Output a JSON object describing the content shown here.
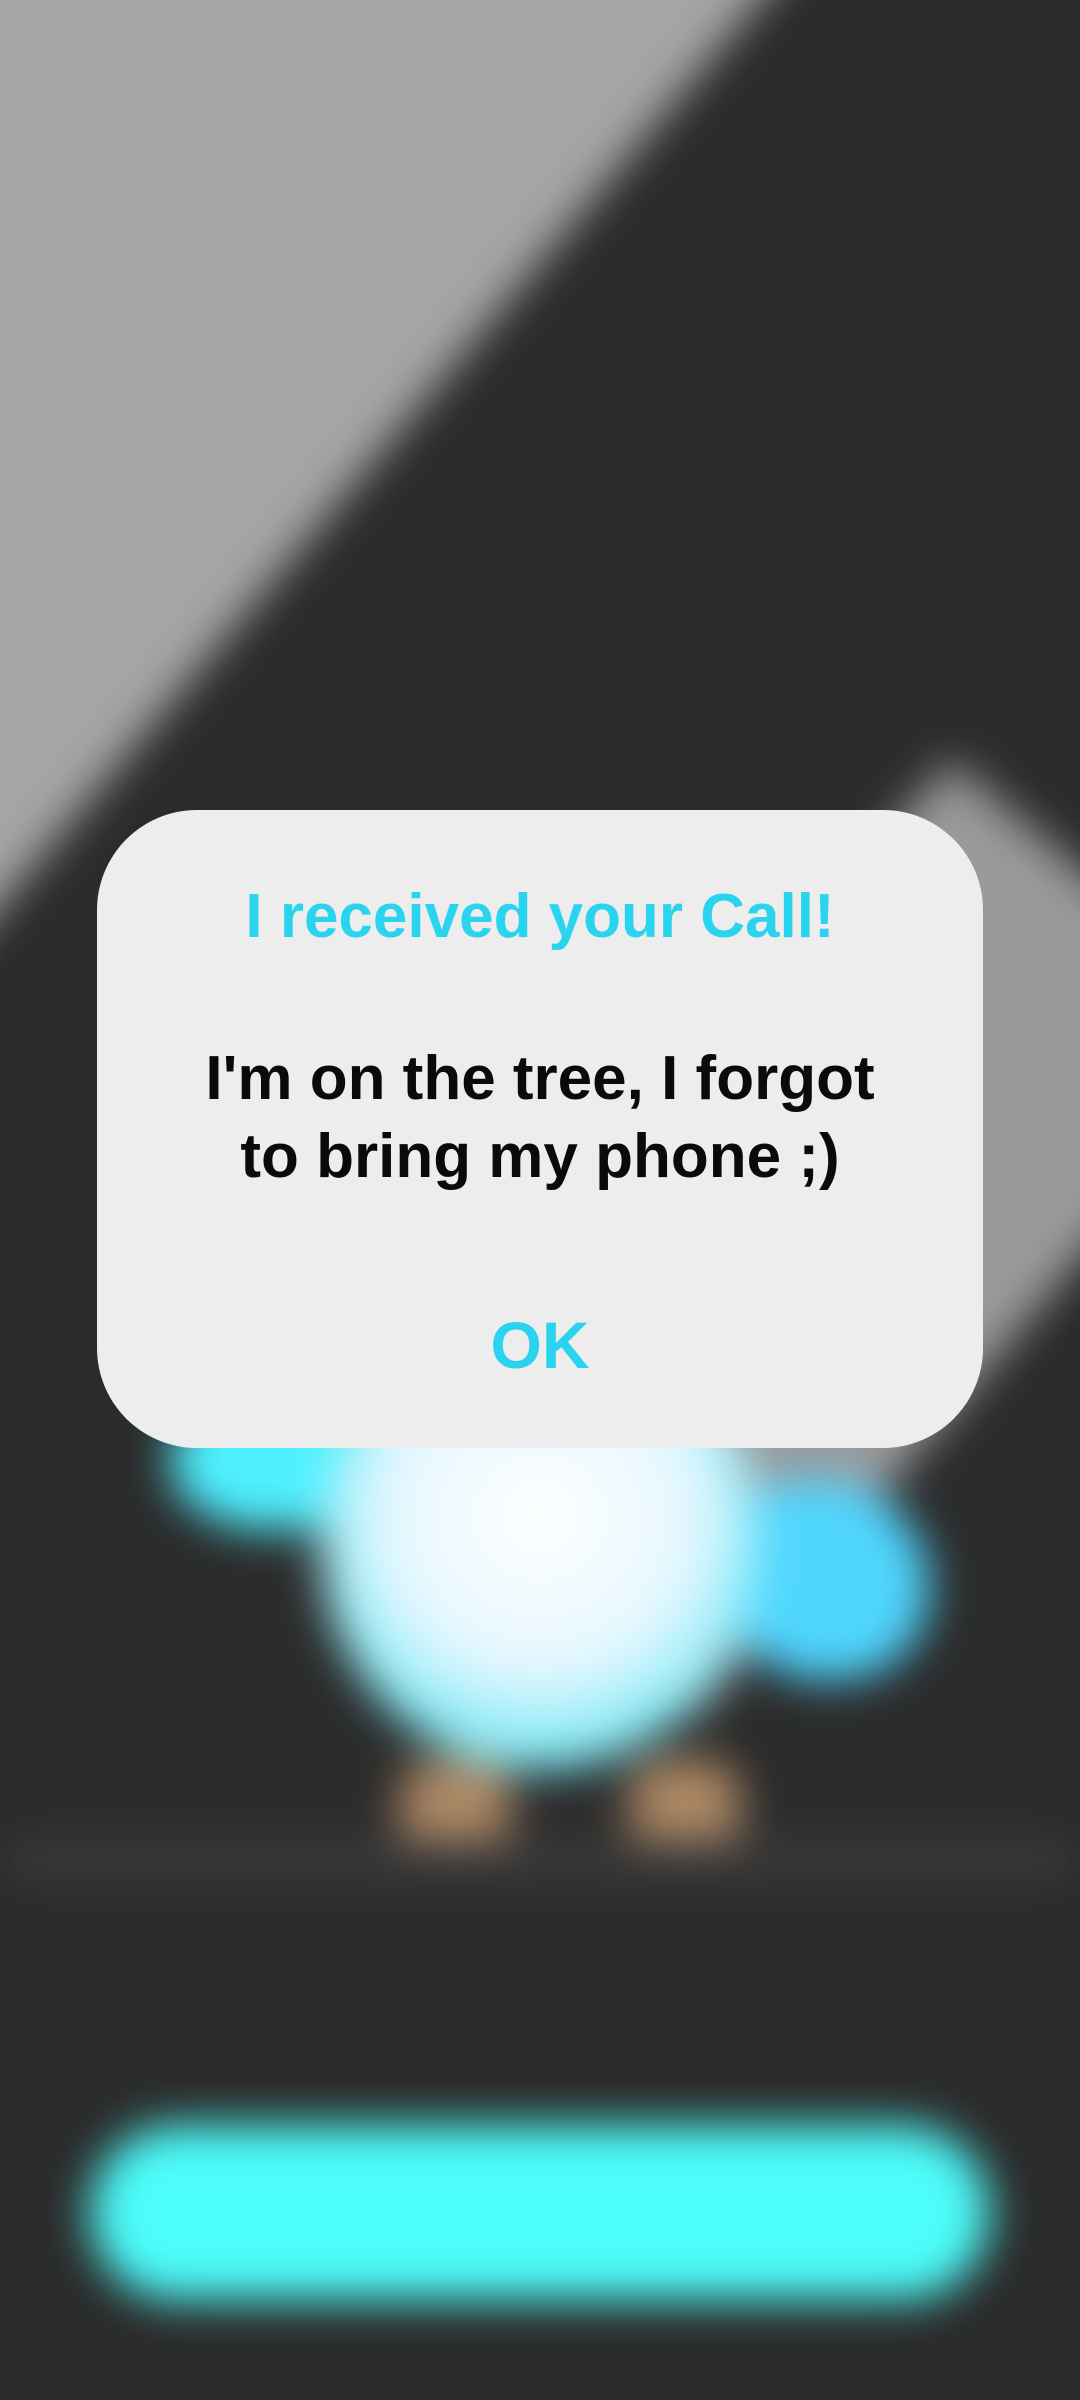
{
  "dialog": {
    "title": "I received your Call!",
    "message": "I'm on the tree, I forgot\nto bring my phone ;)",
    "ok_label": "OK"
  },
  "colors": {
    "accent": "#2ad4ee",
    "dialog_background": "#ededed",
    "app_background": "#2a2a2a",
    "cta_background": "#4dfdfb"
  }
}
